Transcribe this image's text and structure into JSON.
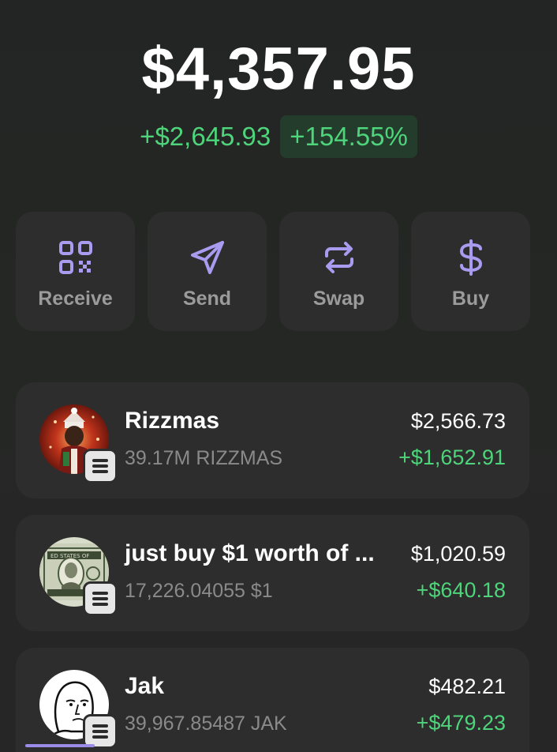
{
  "portfolio": {
    "balance": "$4,357.95",
    "change_abs": "+$2,645.93",
    "change_pct": "+154.55%"
  },
  "actions": [
    {
      "label": "Receive",
      "icon": "qr-code-icon"
    },
    {
      "label": "Send",
      "icon": "send-icon"
    },
    {
      "label": "Swap",
      "icon": "swap-icon"
    },
    {
      "label": "Buy",
      "icon": "dollar-icon"
    }
  ],
  "tokens": [
    {
      "name": "Rizzmas",
      "amount": "39.17M RIZZMAS",
      "value": "$2,566.73",
      "gain": "+$1,652.91",
      "avatar": "rizzmas-avatar"
    },
    {
      "name": "just buy $1 worth of ...",
      "amount": "17,226.04055 $1",
      "value": "$1,020.59",
      "gain": "+$640.18",
      "avatar": "dollar-bill-avatar"
    },
    {
      "name": "Jak",
      "amount": "39,967.85487 JAK",
      "value": "$482.21",
      "gain": "+$479.23",
      "avatar": "wojak-avatar"
    }
  ],
  "colors": {
    "accent": "#a99bf0",
    "positive": "#4ed47a",
    "card": "#2d2d2d",
    "background": "#262626"
  }
}
